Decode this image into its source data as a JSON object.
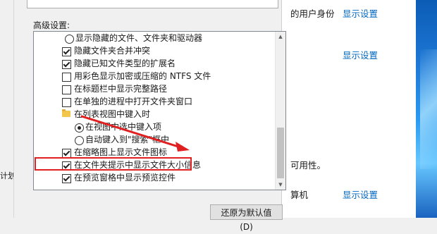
{
  "left_panel": {
    "text": "计划"
  },
  "dialog": {
    "section_label": "高级设置:",
    "items": [
      {
        "kind": "radio",
        "checked": false,
        "label": "显示隐藏的文件、文件夹和驱动器"
      },
      {
        "kind": "checkbox",
        "checked": true,
        "label": "隐藏文件夹合并冲突"
      },
      {
        "kind": "checkbox",
        "checked": true,
        "label": "隐藏已知文件类型的扩展名"
      },
      {
        "kind": "checkbox",
        "checked": false,
        "label": "用彩色显示加密或压缩的 NTFS 文件"
      },
      {
        "kind": "checkbox",
        "checked": false,
        "label": "在标题栏中显示完整路径"
      },
      {
        "kind": "checkbox",
        "checked": false,
        "label": "在单独的进程中打开文件夹窗口"
      },
      {
        "kind": "folder",
        "label": "在列表视图中键入时"
      },
      {
        "kind": "radio",
        "checked": true,
        "label": "在视图中选中键入项"
      },
      {
        "kind": "radio",
        "checked": false,
        "label": "自动键入到\"搜索\"框中"
      },
      {
        "kind": "checkbox",
        "checked": true,
        "label": "在缩略图上显示文件图标"
      },
      {
        "kind": "checkbox",
        "checked": true,
        "label": "在文件夹提示中显示文件大小信息"
      },
      {
        "kind": "checkbox",
        "checked": true,
        "label": "在预览窗格中显示预览控件"
      }
    ],
    "restore_button": "还原为默认值(D)",
    "highlight_color": "#e02020"
  },
  "right_panel": {
    "rows": [
      {
        "text": "的用户身份",
        "link": "显示设置"
      },
      {
        "text": "",
        "link": "显示设置"
      },
      {
        "text": "可用性。",
        "link": ""
      },
      {
        "text": "算机",
        "link": "显示设置"
      }
    ]
  }
}
